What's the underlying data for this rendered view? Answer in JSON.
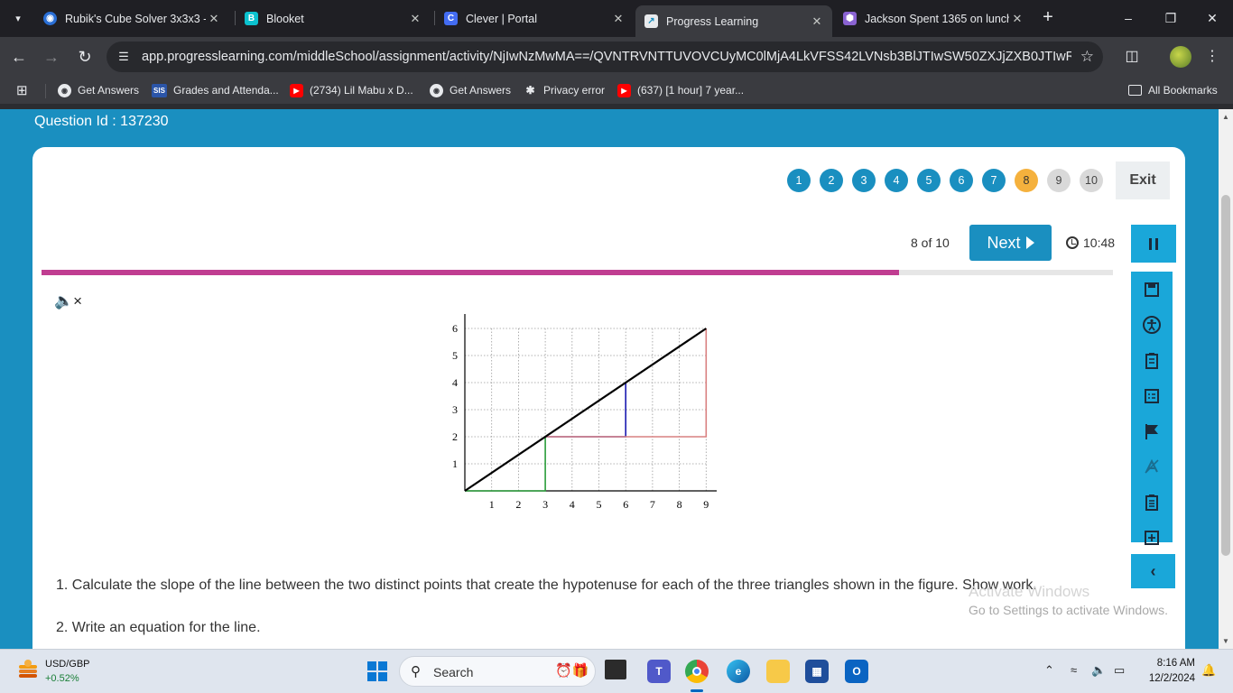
{
  "browser": {
    "tabs": [
      {
        "title": "Rubik's Cube Solver 3x3x3 -",
        "active": false
      },
      {
        "title": "Blooket",
        "active": false
      },
      {
        "title": "Clever | Portal",
        "active": false
      },
      {
        "title": "Progress Learning",
        "active": true
      },
      {
        "title": "Jackson Spent 1365 on lunch",
        "active": false
      }
    ],
    "url": "app.progresslearning.com/middleSchool/assignment/activity/NjIwNzMwMA==/QVNTRVNTTUVOVCUyMC0lMjA4LkVFSS42LVNsb3BlJTIwSW50ZXJjZXB0JTIwRm9ybQ...",
    "bookmarks": [
      "Get Answers",
      "Grades and Attenda...",
      "(2734) Lil Mabu x D...",
      "Get Answers",
      "Privacy error",
      "(637) [1 hour] 7 year...",
      "All Bookmarks"
    ]
  },
  "page": {
    "question_id": "Question Id : 137230",
    "question_numbers": [
      "1",
      "2",
      "3",
      "4",
      "5",
      "6",
      "7",
      "8",
      "9",
      "10"
    ],
    "current_question": 8,
    "exit_label": "Exit",
    "progress_text": "8 of 10",
    "progress_fraction": 0.8,
    "next_label": "Next",
    "timer": "10:48",
    "question_1": "1. Calculate the slope of the line between the two distinct points that create the hypotenuse for each of the three triangles shown in the figure. Show work.",
    "question_2": "2. Write an equation for the line.",
    "watermark_title": "Activate Windows",
    "watermark_sub": "Go to Settings to activate Windows."
  },
  "graph": {
    "x_ticks": [
      "1",
      "2",
      "3",
      "4",
      "5",
      "6",
      "7",
      "8",
      "9"
    ],
    "y_ticks": [
      "1",
      "2",
      "3",
      "4",
      "5",
      "6"
    ],
    "line": {
      "from": [
        0,
        0
      ],
      "to": [
        9,
        6
      ],
      "color": "#000000"
    },
    "triangles": [
      {
        "color": "#2a9d3a",
        "points": [
          [
            0,
            0
          ],
          [
            3,
            0
          ],
          [
            3,
            2
          ]
        ]
      },
      {
        "color": "#1a1ab0",
        "points": [
          [
            3,
            2
          ],
          [
            6,
            2
          ],
          [
            6,
            4
          ]
        ]
      },
      {
        "color": "#d98080",
        "points": [
          [
            3,
            2
          ],
          [
            9,
            2
          ],
          [
            9,
            6
          ]
        ]
      }
    ]
  },
  "taskbar": {
    "stock_name": "USD/GBP",
    "stock_change": "+0.52%",
    "search_label": "Search",
    "time": "8:16 AM",
    "date": "12/2/2024"
  },
  "colors": {
    "page_bg": "#1a8fc0",
    "accent": "#1a8fc0",
    "current_question": "#f5b13d",
    "progress_fill": "#c03d91",
    "tool_panel": "#1aa7d9"
  }
}
